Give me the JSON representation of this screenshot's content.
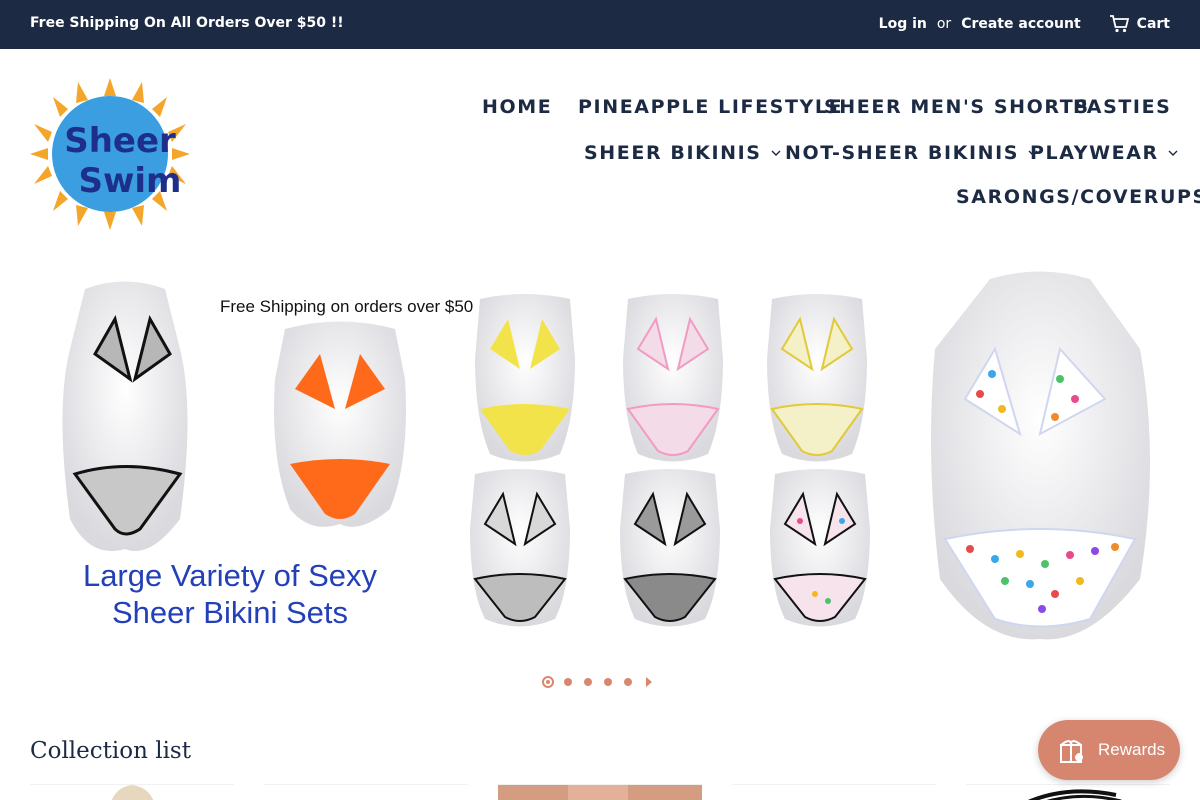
{
  "announcement": {
    "promo": "Free Shipping On All Orders Over $50 !!",
    "login": "Log in",
    "or": "or",
    "create_account": "Create account",
    "cart": "Cart"
  },
  "logo": {
    "line1": "Sheer",
    "line2": "Swim"
  },
  "nav": {
    "home": "HOME",
    "pineapple": "PINEAPPLE LIFESTYLE",
    "mens_shorts": "SHEER MEN'S SHORTS",
    "pasties": "PASTIES",
    "sheer_bikinis": "SHEER BIKINIS",
    "not_sheer_bikinis": "NOT-SHEER BIKINIS",
    "playwear": "PLAYWEAR",
    "sarongs": "SARONGS/COVERUPS"
  },
  "hero": {
    "shipping_text": "Free Shipping on orders over $50",
    "headline_line1": "Large Variety of Sexy",
    "headline_line2": "Sheer Bikini Sets",
    "slides": 5,
    "active_slide": 1
  },
  "collections": {
    "title": "Collection list"
  },
  "rewards": {
    "label": "Rewards"
  },
  "colors": {
    "navy": "#1c2a43",
    "accent": "#d6866f",
    "headline_blue": "#2340b8"
  }
}
